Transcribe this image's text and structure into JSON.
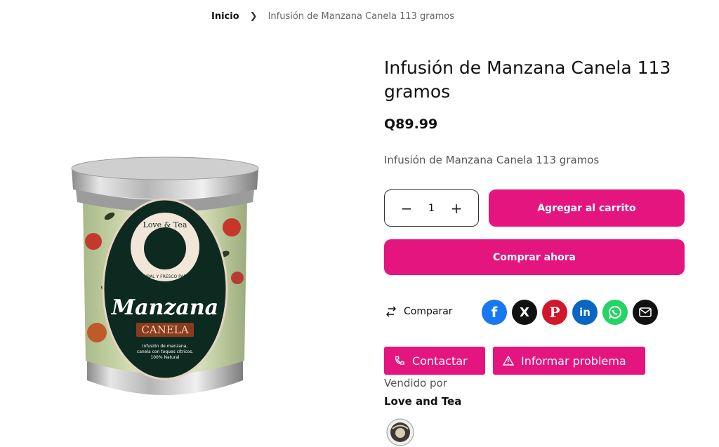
{
  "breadcrumb": {
    "home": "Inicio",
    "current": "Infusión de Manzana Canela 113 gramos"
  },
  "product": {
    "title": "Infusión de Manzana Canela 113 gramos",
    "price": "Q89.99",
    "description": "Infusión de Manzana Canela 113 gramos",
    "image": {
      "brand": "Love & Tea",
      "ring_text": "NATURAL Y FRESCO PARA TI",
      "name": "Manzana",
      "subname": "CANELA",
      "tagline_1": "Infusión de manzana,",
      "tagline_2": "canela con toques cítricos.",
      "tagline_3": "100% Natural"
    }
  },
  "cart": {
    "minus": "−",
    "quantity": "1",
    "plus": "+",
    "add_label": "Agregar al carrito",
    "buy_label": "Comprar ahora"
  },
  "compare_label": "Comparar",
  "share": {
    "icons": [
      "facebook-icon",
      "x-icon",
      "pinterest-icon",
      "linkedin-icon",
      "whatsapp-icon",
      "email-icon"
    ],
    "colors": {
      "facebook": "#1877f2",
      "x": "#111111",
      "pinterest": "#d1182b",
      "linkedin": "#0a66c2",
      "whatsapp": "#25d366",
      "email": "#111111"
    },
    "labels": {
      "facebook": "f",
      "x": "X",
      "pinterest": "P",
      "linkedin": "in"
    }
  },
  "actions": {
    "contact_label": "Contactar",
    "report_label": "Informar problema"
  },
  "seller": {
    "sold_by_label": "Vendido por",
    "name": "Love and Tea"
  },
  "colors": {
    "accent": "#e5157f"
  }
}
